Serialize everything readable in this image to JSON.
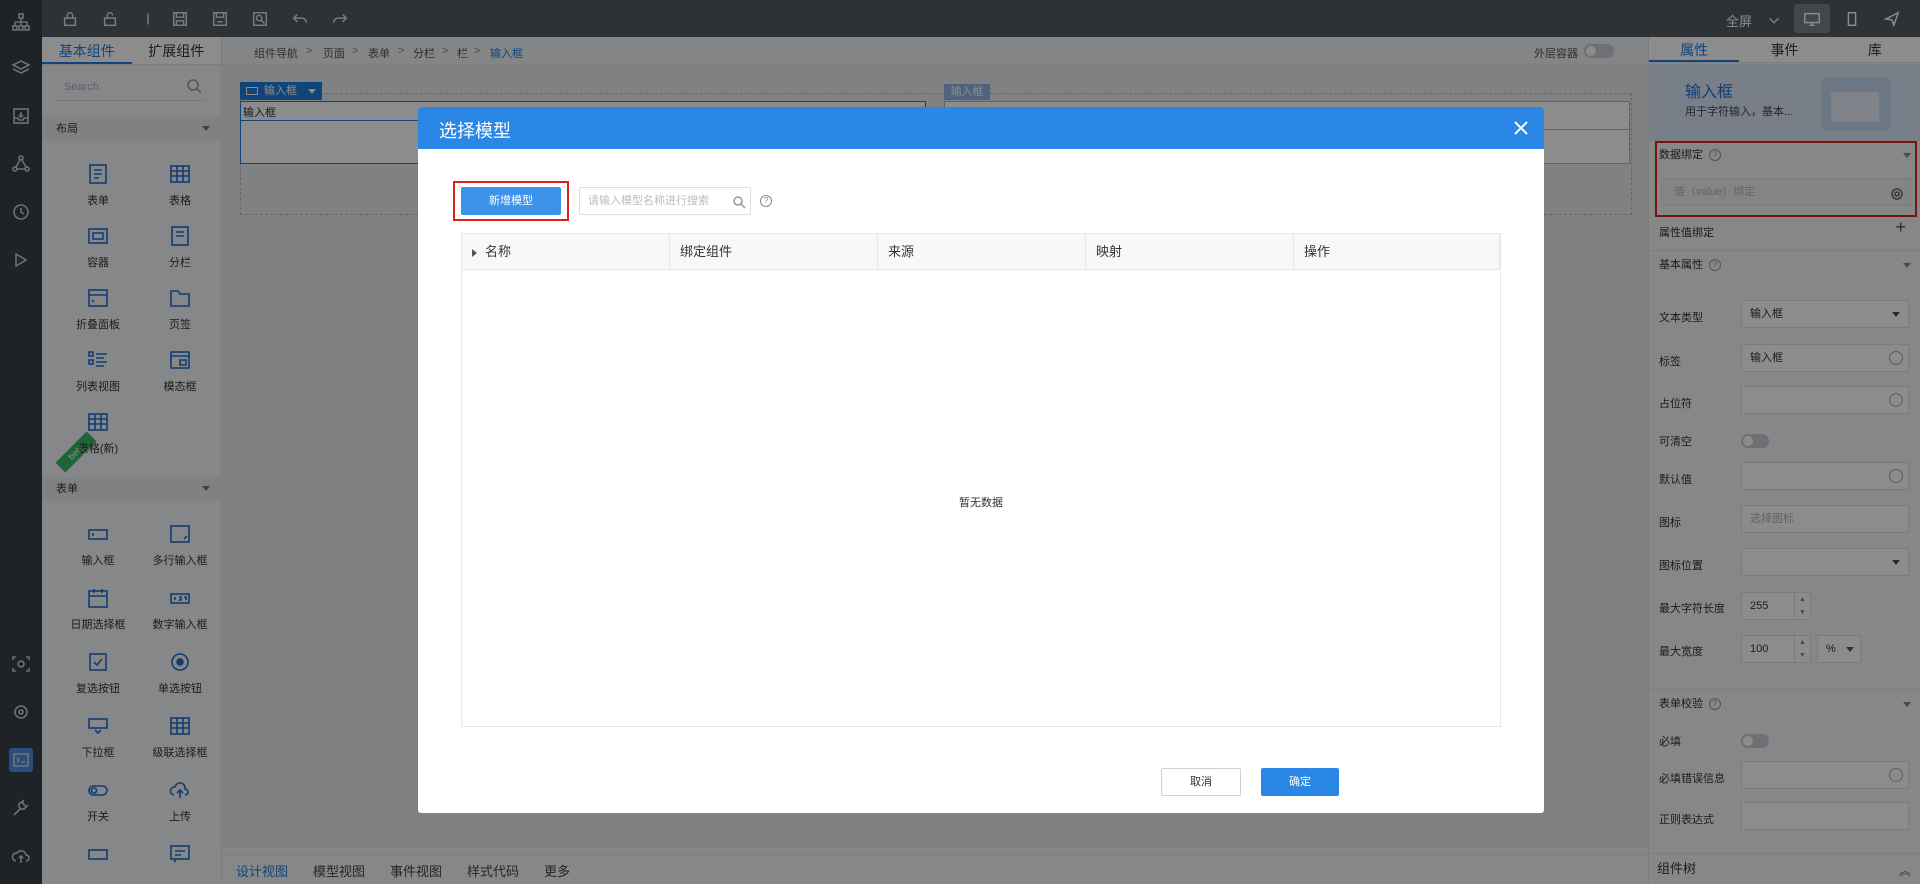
{
  "toolbar": {
    "fullscreen_label": "全屏"
  },
  "left_panel": {
    "tabs": [
      "基本组件",
      "扩展组件"
    ],
    "search_placeholder": "Search",
    "sections": {
      "layout": "布局",
      "form": "表单"
    },
    "layout_items": [
      "表单",
      "表格",
      "容器",
      "分栏",
      "折叠面板",
      "页签",
      "列表视图",
      "模态框",
      "表格(新)"
    ],
    "beta": "beta",
    "form_items": [
      "输入框",
      "多行输入框",
      "日期选择框",
      "数字输入框",
      "复选按钮",
      "单选按钮",
      "下拉框",
      "级联选择框",
      "开关",
      "上传"
    ]
  },
  "breadcrumb": [
    "组件导航",
    "页面",
    "表单",
    "分栏",
    "栏",
    "输入框"
  ],
  "outer_container_label": "外层容器",
  "canvas": {
    "tag1": "输入框",
    "field1_label": "输入框",
    "tag2": "输入框"
  },
  "bottom_tabs": [
    "设计视图",
    "模型视图",
    "事件视图",
    "样式代码",
    "更多"
  ],
  "right_panel": {
    "tabs": [
      "属性",
      "事件",
      "库"
    ],
    "header_title": "输入框",
    "header_desc": "用于字符输入，基本...",
    "data_binding": "数据绑定",
    "value_binding_placeholder": "值（value）绑定",
    "attr_binding": "属性值绑定",
    "basic_props": "基本属性",
    "text_type_label": "文本类型",
    "text_type_value": "输入框",
    "label_label": "标签",
    "label_value": "输入框",
    "placeholder_label": "占位符",
    "clearable_label": "可清空",
    "default_label": "默认值",
    "icon_label": "图标",
    "icon_placeholder": "选择图标",
    "icon_pos_label": "图标位置",
    "maxlen_label": "最大字符长度",
    "maxlen_value": "255",
    "maxwidth_label": "最大宽度",
    "maxwidth_value": "100",
    "maxwidth_unit": "%",
    "validation": "表单校验",
    "required_label": "必填",
    "required_msg_label": "必填错误信息",
    "regex_label": "正则表达式",
    "footer": "组件树"
  },
  "modal": {
    "title": "选择模型",
    "new_button": "新增模型",
    "search_placeholder": "请输入模型名称进行搜索",
    "help": "?",
    "columns": [
      "名称",
      "绑定组件",
      "来源",
      "映射",
      "操作"
    ],
    "empty_text": "暂无数据",
    "cancel": "取消",
    "ok": "确定"
  }
}
